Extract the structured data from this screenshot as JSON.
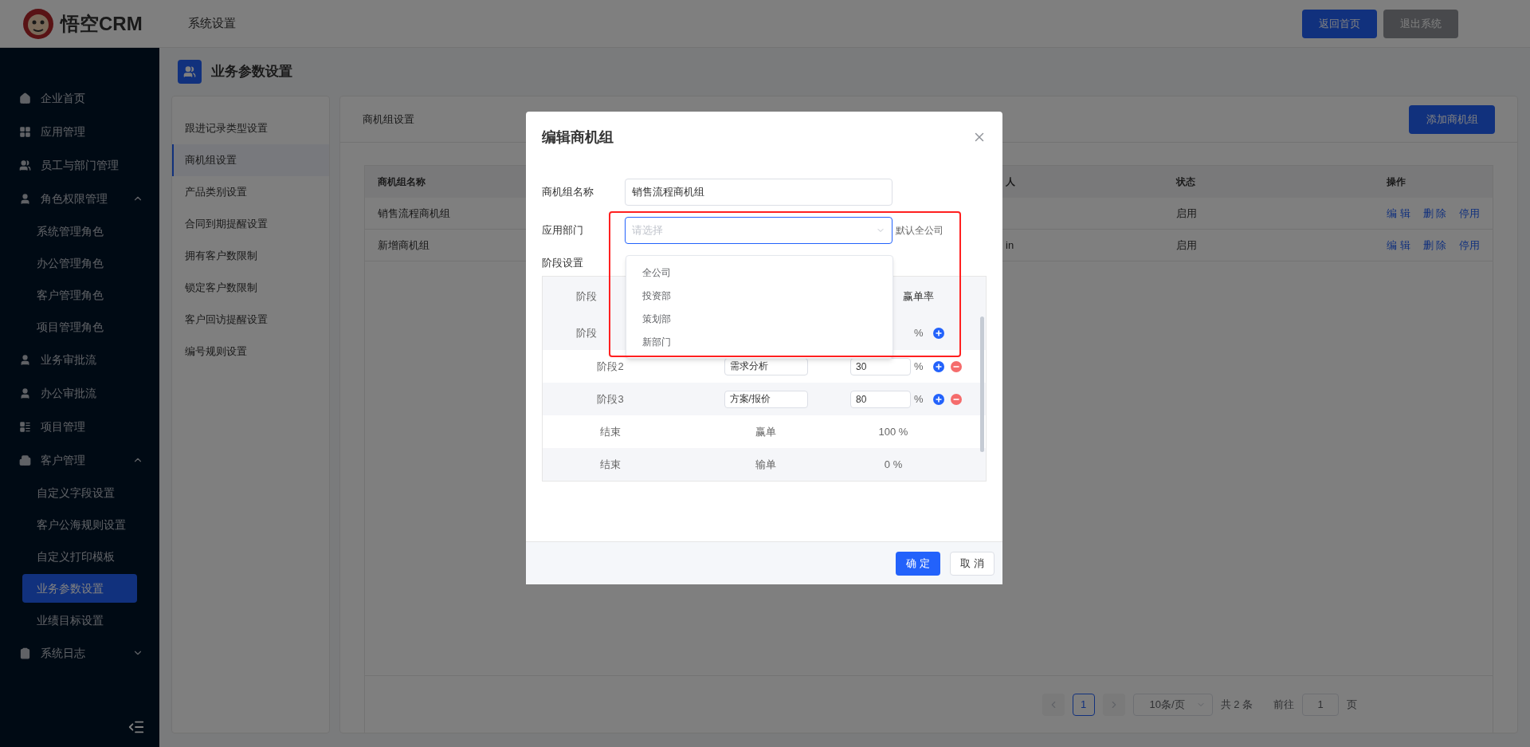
{
  "header": {
    "logo": "悟空CRM",
    "title": "系统设置",
    "buttons": [
      {
        "label": "返回首页",
        "kind": "primary"
      },
      {
        "label": "退出系统",
        "kind": "secondary"
      }
    ]
  },
  "sidebar": {
    "items": [
      {
        "label": "企业首页",
        "kind": "item"
      },
      {
        "label": "应用管理",
        "kind": "item"
      },
      {
        "label": "员工与部门管理",
        "kind": "item"
      },
      {
        "label": "角色权限管理",
        "kind": "group",
        "expanded": true,
        "children": [
          {
            "label": "系统管理角色",
            "selected": false
          },
          {
            "label": "办公管理角色",
            "selected": false
          },
          {
            "label": "客户管理角色",
            "selected": false
          },
          {
            "label": "项目管理角色",
            "selected": false
          }
        ]
      },
      {
        "label": "业务审批流",
        "kind": "item"
      },
      {
        "label": "办公审批流",
        "kind": "item"
      },
      {
        "label": "项目管理",
        "kind": "item"
      },
      {
        "label": "客户管理",
        "kind": "group",
        "expanded": true,
        "children": [
          {
            "label": "自定义字段设置",
            "selected": false
          },
          {
            "label": "客户公海规则设置",
            "selected": false
          },
          {
            "label": "自定义打印模板",
            "selected": false
          },
          {
            "label": "业务参数设置",
            "selected": true
          },
          {
            "label": "业绩目标设置",
            "selected": false
          }
        ]
      },
      {
        "label": "系统日志",
        "kind": "group",
        "expanded": false
      }
    ]
  },
  "page_title": "业务参数设置",
  "submenu": [
    {
      "label": "跟进记录类型设置",
      "selected": false
    },
    {
      "label": "商机组设置",
      "selected": true
    },
    {
      "label": "产品类别设置",
      "selected": false
    },
    {
      "label": "合同到期提醒设置",
      "selected": false
    },
    {
      "label": "拥有客户数限制",
      "selected": false
    },
    {
      "label": "锁定客户数限制",
      "selected": false
    },
    {
      "label": "客户回访提醒设置",
      "selected": false
    },
    {
      "label": "编号规则设置",
      "selected": false
    }
  ],
  "panel": {
    "title": "商机组设置",
    "add_button": "添加商机组"
  },
  "table": {
    "columns": [
      "商机组名称",
      "人",
      "状态",
      "操作"
    ],
    "rows": [
      {
        "name": "销售流程商机组",
        "status": "启用",
        "actions": [
          "编 辑",
          "删 除",
          "停用"
        ]
      },
      {
        "name": "新增商机组",
        "creator": "in",
        "status": "启用",
        "actions": [
          "编 辑",
          "删 除",
          "停用"
        ]
      }
    ]
  },
  "pagination": {
    "pages": [
      {
        "label": "1",
        "selected": true
      }
    ],
    "page_size": "10条/页",
    "total": "共 2 条",
    "goto_label": "前往",
    "goto_value": "1",
    "page_unit": "页"
  },
  "modal": {
    "title": "编辑商机组",
    "name_field": {
      "label": "商机组名称",
      "value": "销售流程商机组"
    },
    "dept_field": {
      "label": "应用部门",
      "placeholder": "请选择",
      "hint": "默认全公司"
    },
    "dropdown_options": [
      "全公司",
      "投资部",
      "策划部",
      "新部门"
    ],
    "stage_label": "阶段设置",
    "stage_headers": [
      "阶段",
      "赢单率"
    ],
    "stages": [
      {
        "kind": "covered",
        "stage": "阶段",
        "unit": "%",
        "removable": false
      },
      {
        "kind": "editable",
        "stage": "阶段2",
        "name": "需求分析",
        "rate": "30",
        "unit": "%",
        "removable": true
      },
      {
        "kind": "editable",
        "stage": "阶段3",
        "name": "方案/报价",
        "rate": "80",
        "unit": "%",
        "removable": true
      },
      {
        "kind": "fixed",
        "stage": "结束",
        "name": "赢单",
        "rate": "100 %"
      },
      {
        "kind": "fixed",
        "stage": "结束",
        "name": "输单",
        "rate": "0 %"
      }
    ],
    "buttons": [
      {
        "label": "确 定",
        "kind": "primary"
      },
      {
        "label": "取 消",
        "kind": "default"
      }
    ]
  }
}
